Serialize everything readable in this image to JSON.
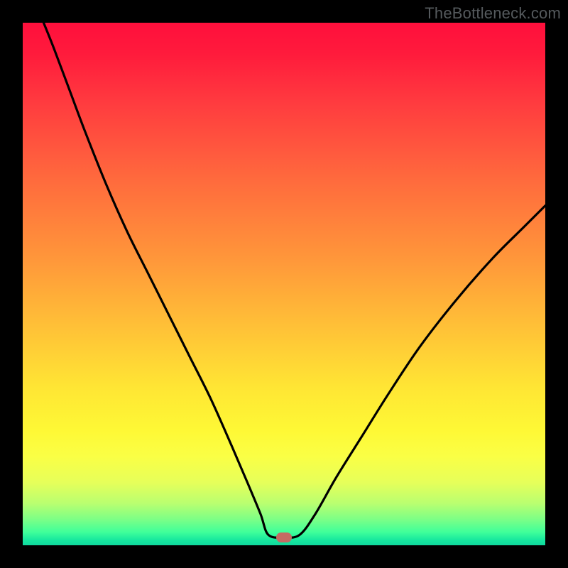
{
  "watermark": "TheBottleneck.com",
  "marker": {
    "x_frac": 0.5,
    "y_frac": 0.985
  },
  "chart_data": {
    "type": "line",
    "title": "",
    "xlabel": "",
    "ylabel": "",
    "xlim": [
      0,
      1
    ],
    "ylim": [
      0,
      1
    ],
    "series": [
      {
        "name": "bottleneck-curve",
        "x": [
          0.04,
          0.06,
          0.09,
          0.12,
          0.16,
          0.2,
          0.24,
          0.28,
          0.32,
          0.36,
          0.4,
          0.43,
          0.455,
          0.47,
          0.5,
          0.53,
          0.56,
          0.6,
          0.65,
          0.7,
          0.76,
          0.83,
          0.9,
          0.96,
          1.0
        ],
        "y": [
          1.0,
          0.95,
          0.87,
          0.79,
          0.69,
          0.6,
          0.52,
          0.44,
          0.36,
          0.28,
          0.19,
          0.12,
          0.06,
          0.02,
          0.015,
          0.02,
          0.06,
          0.13,
          0.21,
          0.29,
          0.38,
          0.47,
          0.55,
          0.61,
          0.65
        ]
      },
      {
        "name": "bottleneck-marker",
        "x": [
          0.5
        ],
        "y": [
          0.015
        ]
      }
    ],
    "gradient_stops": [
      {
        "pos": 0.0,
        "color": "#ff0f3c"
      },
      {
        "pos": 0.3,
        "color": "#ff6a3d"
      },
      {
        "pos": 0.58,
        "color": "#ffc037"
      },
      {
        "pos": 0.78,
        "color": "#fef835"
      },
      {
        "pos": 0.95,
        "color": "#7dff86"
      },
      {
        "pos": 1.0,
        "color": "#0fd99e"
      }
    ]
  }
}
